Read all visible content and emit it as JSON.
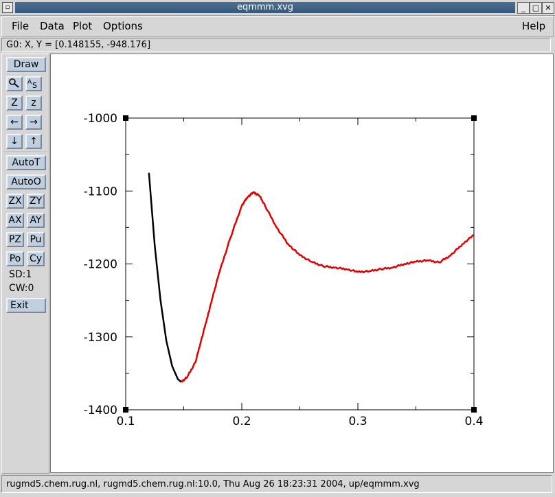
{
  "window": {
    "title": "eqmmm.xvg",
    "controls": {
      "minimize": "_",
      "maximize": "□",
      "close": "✕"
    }
  },
  "menu": {
    "file": "File",
    "data": "Data",
    "plot": "Plot",
    "options": "Options",
    "help": "Help"
  },
  "coord_readout": "G0: X, Y = [0.148155, -948.176]",
  "tools": {
    "draw": "Draw",
    "zoom_icon": "magnifier-icon",
    "autoscale_icon": "as-icon",
    "zoom_in": "Z",
    "zoom_out": "z",
    "left_arrow": "←",
    "right_arrow": "→",
    "down_arrow": "↓",
    "up_arrow": "↑",
    "autot": "AutoT",
    "autoo": "AutoO",
    "zx": "ZX",
    "zy": "ZY",
    "ax": "AX",
    "ay": "AY",
    "pz": "PZ",
    "pu": "Pu",
    "po": "Po",
    "cy": "Cy",
    "sd": "SD:1",
    "cw": "CW:0",
    "exit": "Exit"
  },
  "status": "rugmd5.chem.rug.nl, rugmd5.chem.rug.nl:10.0, Thu Aug 26 18:23:31 2004, up/eqmmm.xvg",
  "chart_data": {
    "type": "line",
    "xlim": [
      0.1,
      0.4
    ],
    "ylim": [
      -1400,
      -1000
    ],
    "x_ticks": [
      "0.1",
      "0.2",
      "0.3",
      "0.4"
    ],
    "y_ticks": [
      "-1000",
      "-1100",
      "-1200",
      "-1300",
      "-1400"
    ],
    "series": [
      {
        "color": "#000000",
        "x": [
          0.12,
          0.125,
          0.13,
          0.135,
          0.14,
          0.145,
          0.148
        ],
        "y": [
          -1075,
          -1175,
          -1250,
          -1305,
          -1340,
          -1358,
          -1362
        ]
      },
      {
        "color": "#e00000",
        "x": [
          0.148,
          0.153,
          0.16,
          0.165,
          0.17,
          0.175,
          0.18,
          0.19,
          0.2,
          0.205,
          0.21,
          0.215,
          0.22,
          0.23,
          0.24,
          0.25,
          0.26,
          0.27,
          0.28,
          0.29,
          0.3,
          0.31,
          0.32,
          0.33,
          0.34,
          0.35,
          0.36,
          0.37,
          0.38,
          0.39,
          0.4
        ],
        "y": [
          -1362,
          -1355,
          -1335,
          -1305,
          -1275,
          -1245,
          -1215,
          -1165,
          -1120,
          -1108,
          -1102,
          -1106,
          -1120,
          -1150,
          -1173,
          -1188,
          -1197,
          -1203,
          -1205,
          -1207,
          -1211,
          -1210,
          -1207,
          -1205,
          -1200,
          -1197,
          -1195,
          -1198,
          -1188,
          -1173,
          -1160
        ]
      }
    ]
  }
}
